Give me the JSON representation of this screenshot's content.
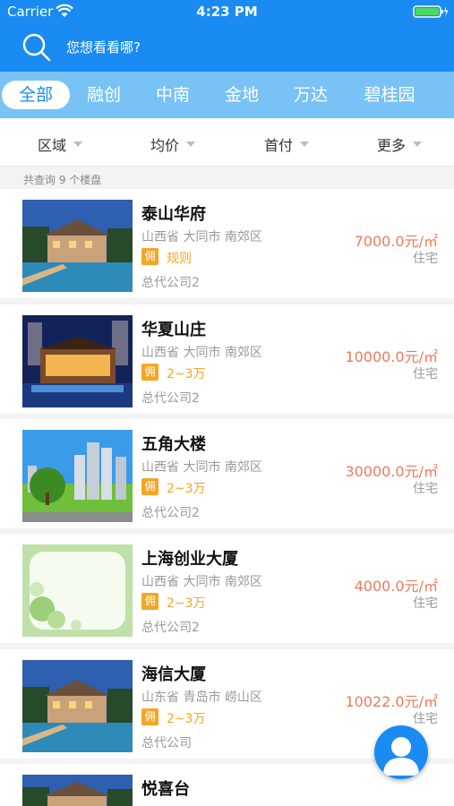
{
  "status_bar": {
    "carrier": "Carrier",
    "time": "4:23 PM"
  },
  "search": {
    "placeholder": "您想看看哪?"
  },
  "tabs": [
    "全部",
    "融创",
    "中南",
    "金地",
    "万达",
    "碧桂园"
  ],
  "filters": [
    "区域",
    "均价",
    "首付",
    "更多"
  ],
  "result_count": "共查询 9 个楼盘",
  "listings": [
    {
      "name": "泰山华府",
      "location": "山西省 大同市 南郊区",
      "tag": "佣",
      "commission": "规则",
      "agent": "总代公司2",
      "price": "7000.0元/㎡",
      "type": "住宅"
    },
    {
      "name": "华夏山庄",
      "location": "山西省 大同市 南郊区",
      "tag": "佣",
      "commission": "2~3万",
      "agent": "总代公司2",
      "price": "10000.0元/㎡",
      "type": "住宅"
    },
    {
      "name": "五角大楼",
      "location": "山西省 大同市 南郊区",
      "tag": "佣",
      "commission": "2~3万",
      "agent": "总代公司2",
      "price": "30000.0元/㎡",
      "type": "住宅"
    },
    {
      "name": "上海创业大厦",
      "location": "山西省 大同市 南郊区",
      "tag": "佣",
      "commission": "2~3万",
      "agent": "总代公司2",
      "price": "4000.0元/㎡",
      "type": "住宅"
    },
    {
      "name": "海信大厦",
      "location": "山东省 青岛市 崂山区",
      "tag": "佣",
      "commission": "2~3万",
      "agent": "总代公司",
      "price": "10022.0元/㎡",
      "type": "住宅"
    },
    {
      "name": "悦喜台"
    }
  ],
  "colors": {
    "primary": "#1a8bf3",
    "tab_strip": "#78c2f6",
    "price": "#ef7a5b",
    "tag": "#f5a623"
  },
  "icons": {
    "search": "search-icon",
    "wifi": "wifi-icon",
    "battery": "battery-icon",
    "caret": "caret-down-icon",
    "fab": "user-avatar-icon"
  }
}
